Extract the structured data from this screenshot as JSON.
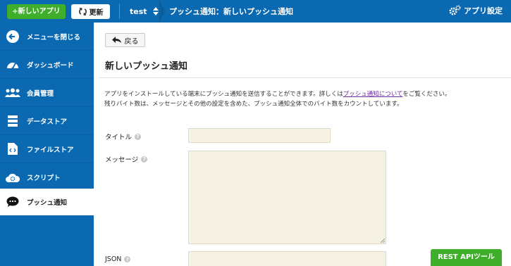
{
  "header": {
    "new_app_label": "+新しいアプリ",
    "refresh_label": "更新",
    "app_name": "test",
    "breadcrumb_title": "プッシュ通知：新しいプッシュ通知",
    "app_settings_label": "アプリ設定"
  },
  "sidebar": {
    "items": [
      {
        "label": "メニューを閉じる",
        "icon": "arrow-left-circle-icon"
      },
      {
        "label": "ダッシュボード",
        "icon": "dashboard-icon"
      },
      {
        "label": "会員管理",
        "icon": "users-icon"
      },
      {
        "label": "データストア",
        "icon": "database-icon"
      },
      {
        "label": "ファイルストア",
        "icon": "file-code-icon"
      },
      {
        "label": "スクリプト",
        "icon": "cloud-gear-icon"
      },
      {
        "label": "プッシュ通知",
        "icon": "chat-bubble-icon",
        "active": true
      }
    ]
  },
  "main": {
    "back_label": "戻る",
    "title": "新しいプッシュ通知",
    "desc_line1_prefix": "アプリをインストールしている端末にプッシュ通知を送信することができます。詳しくは",
    "desc_link": "プッシュ通知について",
    "desc_line1_suffix": "をご覧ください。",
    "desc_line2": "残りバイト数は、メッセージとその他の設定を含めた、プッシュ通知全体でのバイト数をカウントしています。",
    "fields": {
      "title_label": "タイトル",
      "message_label": "メッセージ",
      "json_label": "JSON"
    },
    "help_glyph": "?",
    "rest_api_label": "REST APIツール"
  },
  "colors": {
    "brand_blue": "#0b69b1",
    "accent_green": "#3fae2a",
    "field_bg": "#f5f2e4"
  }
}
